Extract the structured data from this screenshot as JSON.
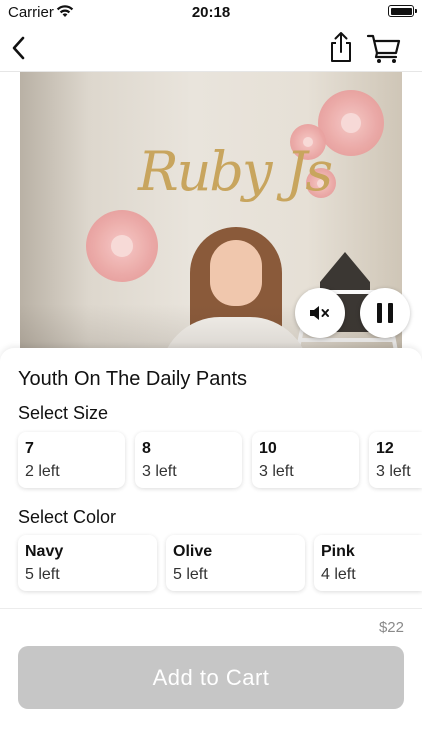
{
  "status_bar": {
    "carrier": "Carrier",
    "time": "20:18"
  },
  "nav": {
    "back_icon": "chevron-left-icon",
    "share_icon": "share-icon",
    "cart_icon": "cart-icon"
  },
  "video": {
    "sign_text": "Ruby Js",
    "mute_icon": "speaker-muted-icon",
    "pause_icon": "pause-icon"
  },
  "product": {
    "title": "Youth On The Daily Pants",
    "size_label": "Select Size",
    "sizes": [
      {
        "name": "7",
        "stock": "2 left"
      },
      {
        "name": "8",
        "stock": "3 left"
      },
      {
        "name": "10",
        "stock": "3 left"
      },
      {
        "name": "12",
        "stock": "3 left"
      }
    ],
    "color_label": "Select Color",
    "colors": [
      {
        "name": "Navy",
        "stock": "5 left"
      },
      {
        "name": "Olive",
        "stock": "5 left"
      },
      {
        "name": "Pink",
        "stock": "4 left"
      }
    ],
    "price": "$22",
    "add_to_cart_label": "Add to Cart"
  }
}
